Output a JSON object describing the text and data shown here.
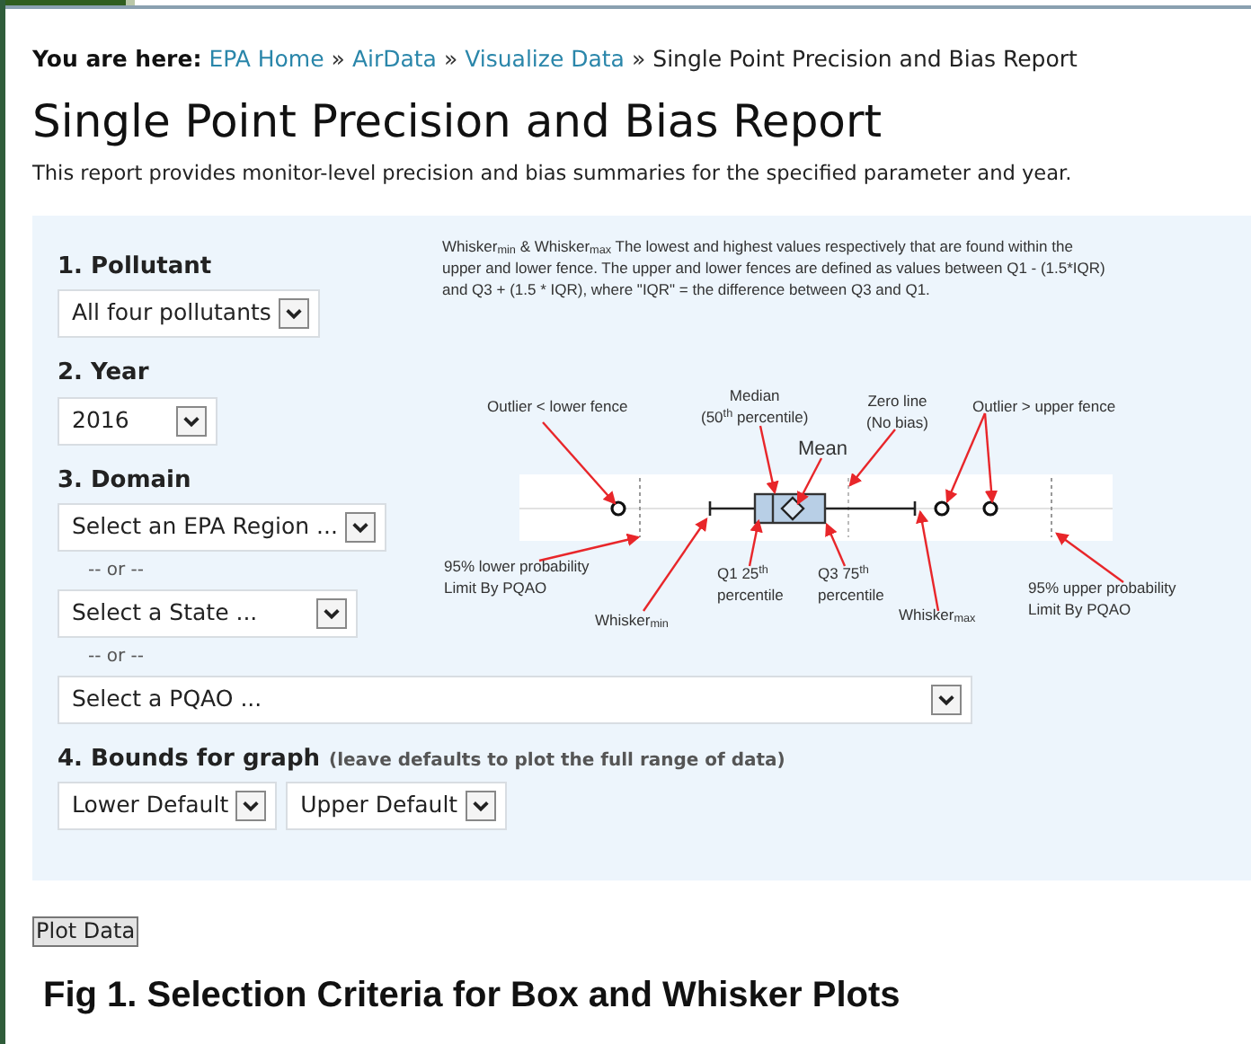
{
  "breadcrumb": {
    "label": "You are here:",
    "items": [
      {
        "text": "EPA Home",
        "kind": "link"
      },
      {
        "sep": "»",
        "text": "AirData",
        "kind": "link"
      },
      {
        "sep": "»",
        "text": "Visualize Data",
        "kind": "link"
      },
      {
        "sep": "»",
        "text": "Single Point Precision and Bias Report",
        "kind": "current"
      }
    ]
  },
  "title": "Single Point Precision and Bias Report",
  "description": "This report provides monitor-level precision and bias summaries for the specified parameter and year.",
  "form": {
    "pollutant": {
      "label": "1. Pollutant",
      "value": "All four pollutants"
    },
    "year": {
      "label": "2. Year",
      "value": "2016"
    },
    "domain": {
      "label": "3. Domain",
      "region": "Select an EPA Region ...",
      "or_1": "-- or --",
      "state": "Select a State ...",
      "or_2": "-- or --",
      "pqao": "Select a PQAO ..."
    },
    "bounds": {
      "label": "4. Bounds for graph",
      "note": "(leave defaults to plot the full range of data)",
      "lower": "Lower Default",
      "upper": "Upper Default"
    }
  },
  "diagram": {
    "note": "Whisker$_{min}$ & Whisker$_{max}$ The lowest and highest values respectively that are found within the upper and lower fence.  The upper and lower fences are defined as values between Q1 - (1.5*IQR) and Q3 + (1.5 * IQR), where \"IQR\" = the difference between Q3 and Q1.",
    "labels": [
      {
        "lines": [
          "Outlier < lower fence"
        ]
      },
      {
        "lines": [
          "Median",
          "(50$^{th}$ percentile)"
        ]
      },
      {
        "lines": [
          "Mean"
        ]
      },
      {
        "lines": [
          "Zero line",
          "(No bias)"
        ]
      },
      {
        "lines": [
          "Outlier > upper fence"
        ]
      },
      {
        "lines": [
          "95% lower probability",
          "Limit By PQAO"
        ]
      },
      {
        "lines": [
          "Q1 25$^{th}$",
          "percentile"
        ]
      },
      {
        "lines": [
          "Q3 75$^{th}$",
          "percentile"
        ]
      },
      {
        "lines": [
          "Whisker$_{min}$"
        ]
      },
      {
        "lines": [
          "Whisker$_{max}$"
        ]
      },
      {
        "lines": [
          "95%  upper probability",
          "Limit By PQAO"
        ]
      }
    ]
  },
  "plot_button": "Plot Data",
  "caption": "Fig 1. Selection Criteria for Box and Whisker Plots"
}
